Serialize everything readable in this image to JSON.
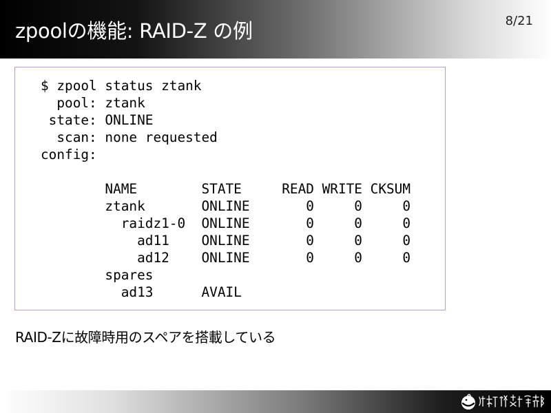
{
  "header": {
    "title": "zpoolの機能: RAID-Z の例",
    "page_number": "8/21"
  },
  "console": {
    "lines": [
      "$ zpool status ztank",
      "  pool: ztank",
      " state: ONLINE",
      "  scan: none requested",
      "config:",
      "",
      "        NAME        STATE     READ WRITE CKSUM",
      "        ztank       ONLINE       0     0     0",
      "          raidz1-0  ONLINE       0     0     0",
      "            ad11    ONLINE       0     0     0",
      "            ad12    ONLINE       0     0     0",
      "        spares",
      "          ad13      AVAIL"
    ]
  },
  "caption": "RAID-Zに故障時用のスペアを搭載している",
  "colors": {
    "code_border": "#b89ad6",
    "title_text": "#ffffff"
  }
}
